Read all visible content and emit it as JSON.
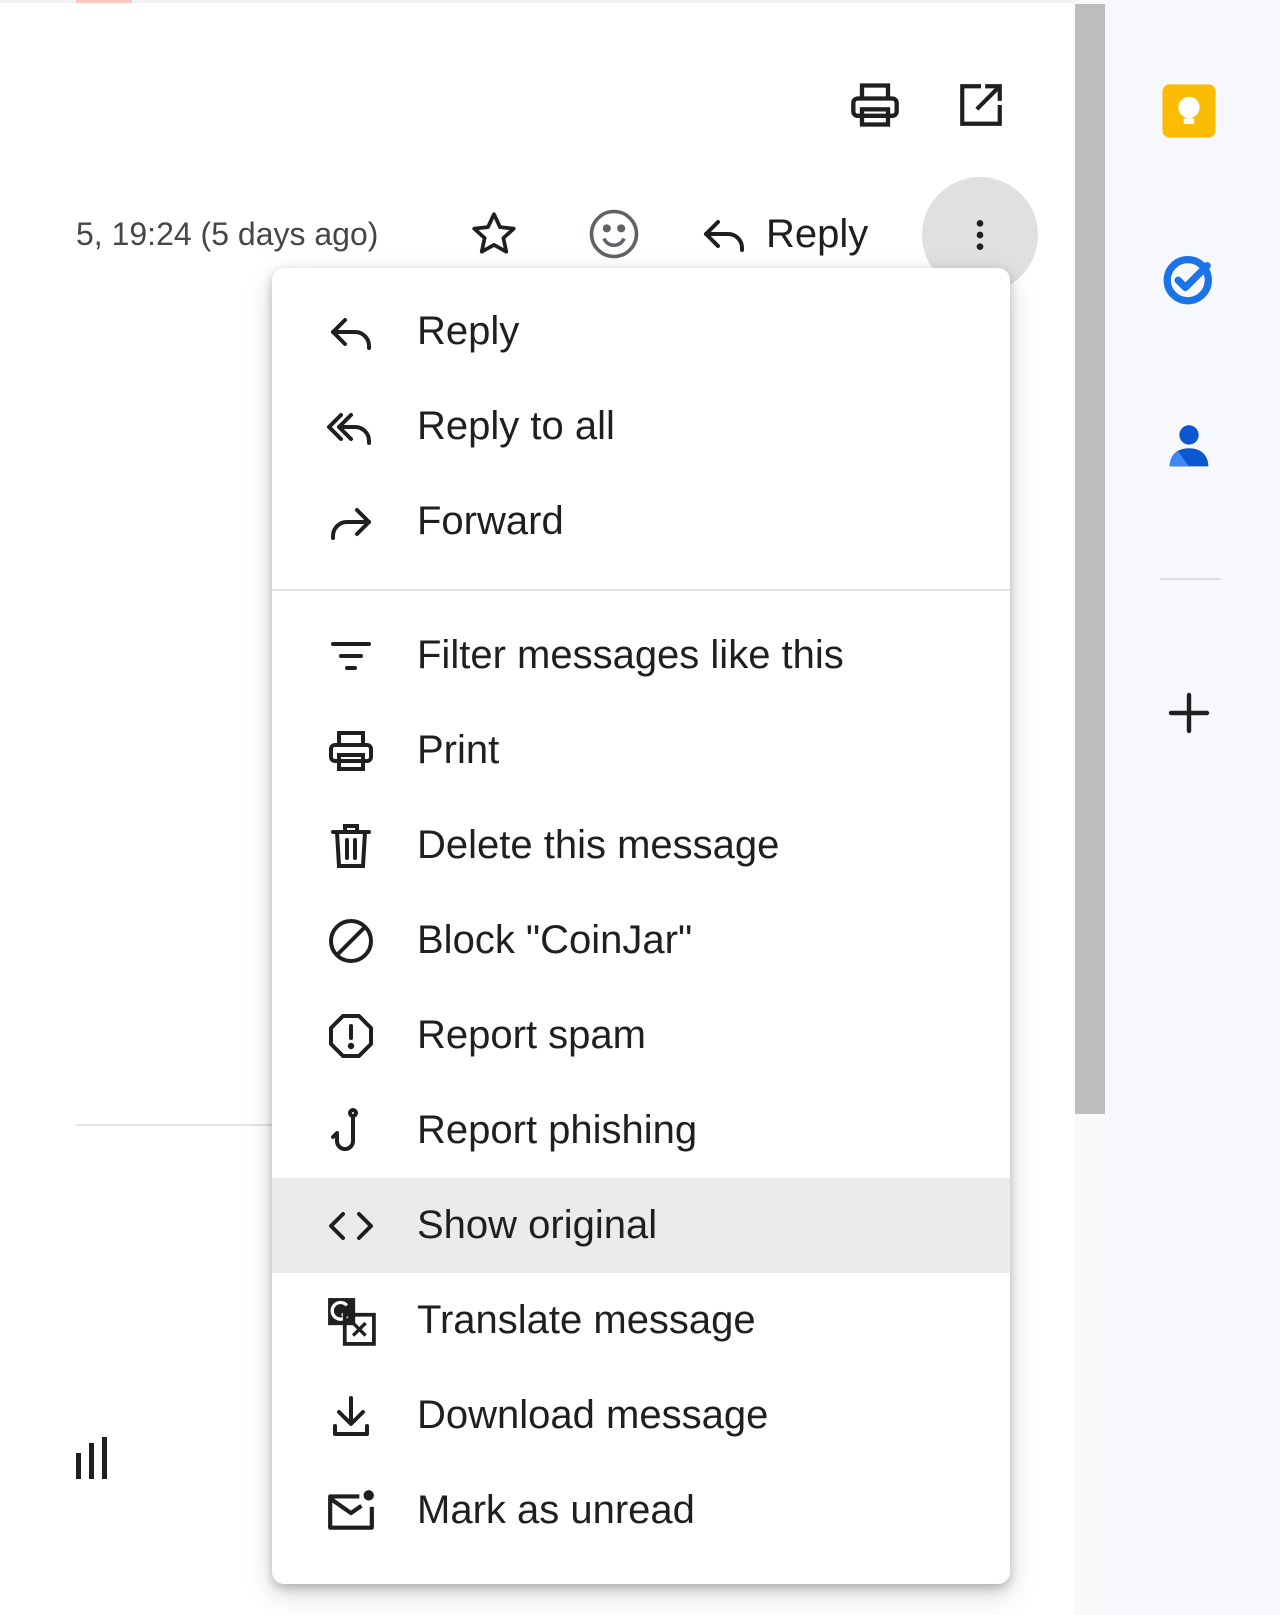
{
  "header": {
    "date_text": "5, 19:24 (5 days ago)",
    "reply_label": "Reply"
  },
  "menu": {
    "items": [
      {
        "label": "Reply",
        "icon": "reply-icon"
      },
      {
        "label": "Reply to all",
        "icon": "reply-all-icon"
      },
      {
        "label": "Forward",
        "icon": "forward-icon"
      },
      {
        "label": "Filter messages like this",
        "icon": "filter-icon"
      },
      {
        "label": "Print",
        "icon": "print-icon"
      },
      {
        "label": "Delete this message",
        "icon": "trash-icon"
      },
      {
        "label": "Block \"CoinJar\"",
        "icon": "block-icon"
      },
      {
        "label": "Report spam",
        "icon": "report-spam-icon"
      },
      {
        "label": "Report phishing",
        "icon": "phishing-hook-icon"
      },
      {
        "label": "Show original",
        "icon": "code-icon",
        "highlighted": true
      },
      {
        "label": "Translate message",
        "icon": "translate-icon"
      },
      {
        "label": "Download message",
        "icon": "download-icon"
      },
      {
        "label": "Mark as unread",
        "icon": "mark-unread-icon"
      }
    ]
  },
  "side_panel": {
    "icons": [
      "keep-icon",
      "tasks-icon",
      "contacts-icon",
      "add-icon"
    ]
  },
  "colors": {
    "keep": "#fbbc04",
    "tasks": "#1a73e8",
    "contacts": "#0b57d0",
    "menu_highlight": "#ebebeb",
    "more_button_bg": "#e0e0e0"
  }
}
